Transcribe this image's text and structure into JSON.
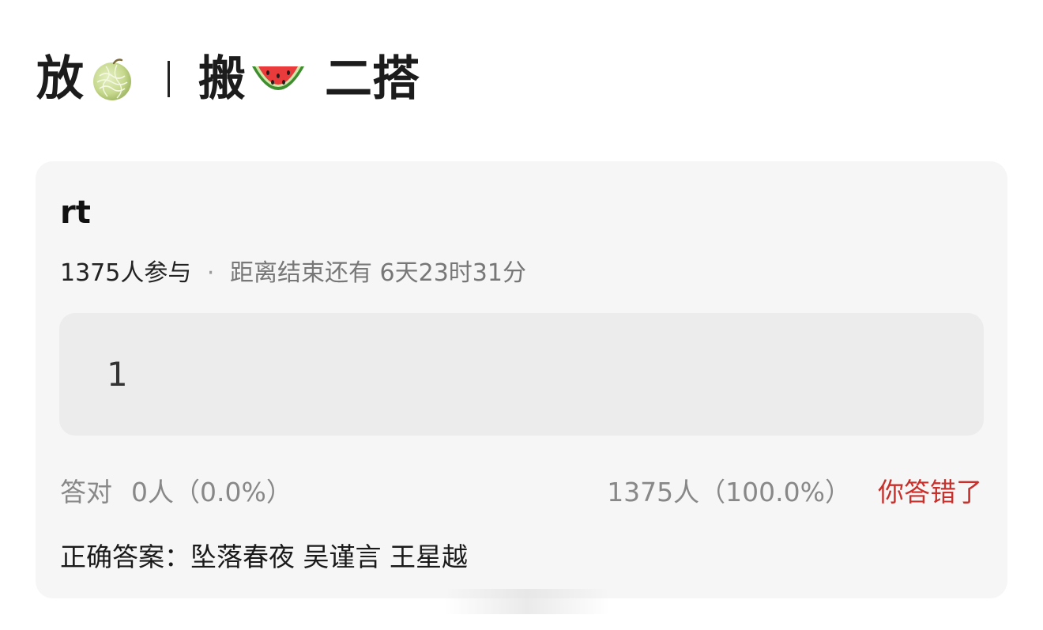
{
  "post": {
    "title_part1": "放",
    "title_part2": "搬",
    "title_part3": "二搭",
    "icons": [
      "melon-icon",
      "divider",
      "watermelon-icon"
    ]
  },
  "quiz": {
    "title": "rt",
    "participants": "1375人参与",
    "separator": "·",
    "time_left": "距离结束还有 6天23时31分",
    "options": [
      {
        "label": "1"
      }
    ],
    "correct_stat_label": "答对",
    "correct_stat_value": "0人（0.0%）",
    "wrong_stat_value": "1375人（100.0%）",
    "result_text": "你答错了",
    "answer_text": "正确答案：坠落春夜 吴谨言 王星越"
  },
  "colors": {
    "card_bg": "#f6f6f6",
    "option_bg": "#ececec",
    "wrong_red": "#c8302c",
    "muted_text": "#888888"
  }
}
